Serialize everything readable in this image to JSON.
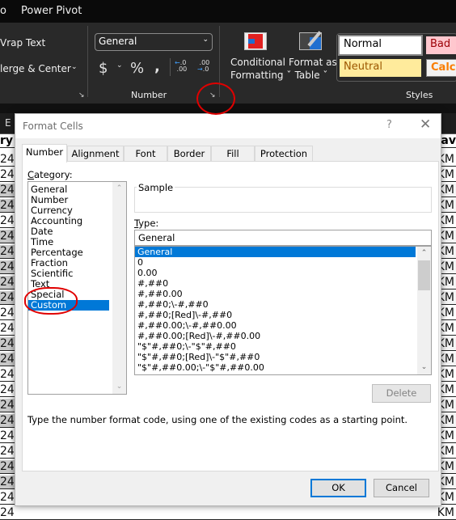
{
  "menubar": {
    "partial_tab": "o",
    "tab_power_pivot": "Power Pivot"
  },
  "ribbon": {
    "alignment": {
      "wrap_text": "Vrap Text",
      "merge_center": "lerge & Center"
    },
    "number": {
      "format_select_value": "General",
      "currency_symbol": "$",
      "percent_symbol": "%",
      "comma_symbol": "ʕ",
      "increase_decimal": "←.0 .00",
      "decrease_decimal": ".00 →.0",
      "group_label": "Number"
    },
    "conditional_formatting": {
      "line1": "Conditional",
      "line2": "Formatting ˇ"
    },
    "format_as_table": {
      "line1": "Format as",
      "line2": "Table ˇ"
    },
    "styles": {
      "normal": "Normal",
      "bad": "Bad",
      "neutral": "Neutral",
      "calculation": "Calcu",
      "group_label": "Styles"
    }
  },
  "sheet": {
    "column_header": "E",
    "header_left": "ry T",
    "header_right": "rav",
    "row_left": "24",
    "row_right": "KM"
  },
  "dialog": {
    "title": "Format Cells",
    "help": "?",
    "close": "✕",
    "tabs": [
      "Number",
      "Alignment",
      "Font",
      "Border",
      "Fill",
      "Protection"
    ],
    "active_tab": "Number",
    "category_label": "Category:",
    "categories": [
      "General",
      "Number",
      "Currency",
      "Accounting",
      "Date",
      "Time",
      "Percentage",
      "Fraction",
      "Scientific",
      "Text",
      "Special",
      "Custom"
    ],
    "selected_category": "Custom",
    "sample_label": "Sample",
    "type_label": "Type:",
    "type_value": "General",
    "type_options": [
      "General",
      "0",
      "0.00",
      "#,##0",
      "#,##0.00",
      "#,##0;\\-#,##0",
      "#,##0;[Red]\\-#,##0",
      "#,##0.00;\\-#,##0.00",
      "#,##0.00;[Red]\\-#,##0.00",
      "\"$\"#,##0;\\-\"$\"#,##0",
      "\"$\"#,##0;[Red]\\-\"$\"#,##0",
      "\"$\"#,##0.00;\\-\"$\"#,##0.00"
    ],
    "selected_type": "General",
    "delete_label": "Delete",
    "hint": "Type the number format code, using one of the existing codes as a starting point.",
    "ok_label": "OK",
    "cancel_label": "Cancel"
  },
  "colors": {
    "accent": "#0078d7",
    "annotation": "#e00000",
    "bad_bg": "#ffc7ce",
    "bad_fg": "#9c0006",
    "neutral_bg": "#ffeb9c",
    "neutral_fg": "#9c5700",
    "calc_fg": "#fa7d00"
  }
}
